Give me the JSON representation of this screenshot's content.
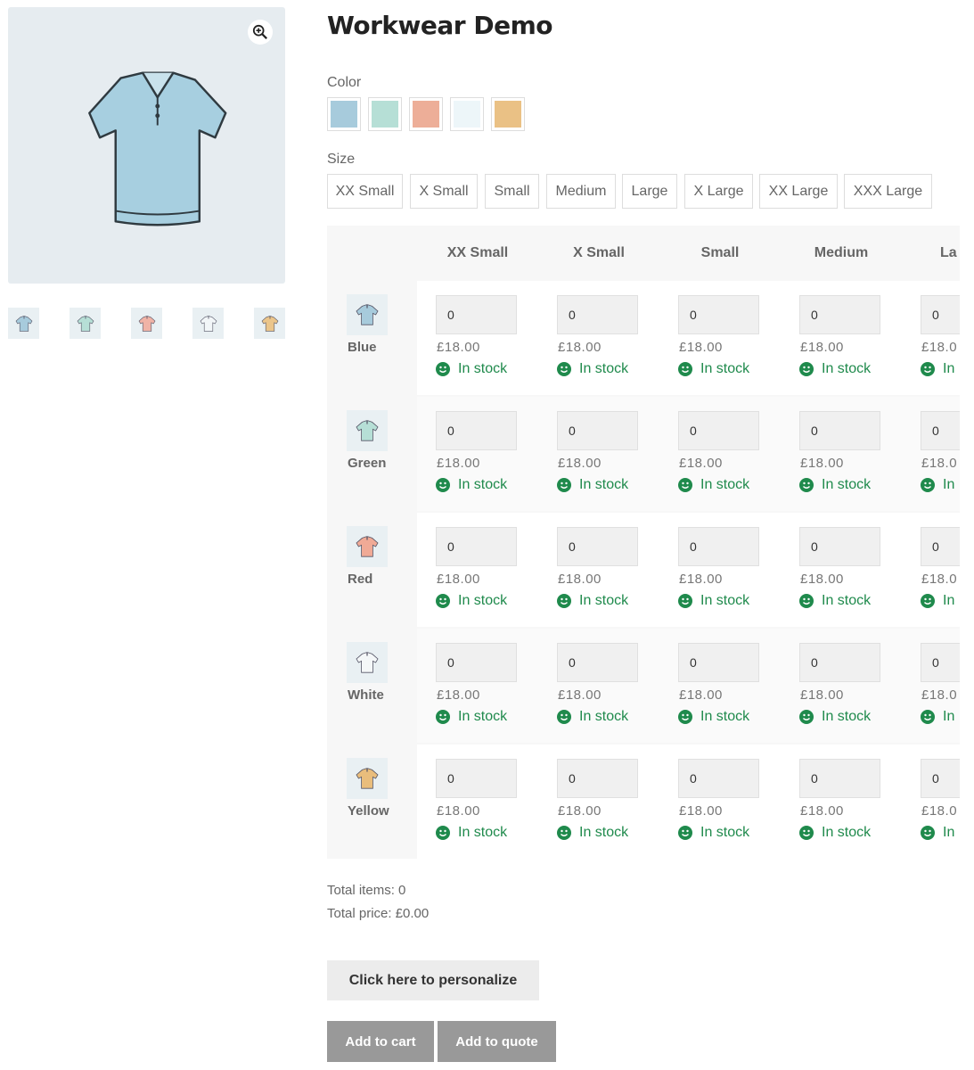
{
  "product": {
    "title": "Workwear Demo"
  },
  "gallery": {
    "zoom_icon": "zoom-in-icon",
    "thumbnails": [
      {
        "color": "#a7cbdc"
      },
      {
        "color": "#b6dfd6"
      },
      {
        "color": "#f0b3a6"
      },
      {
        "color": "#f2f6f8"
      },
      {
        "color": "#ebc58a"
      }
    ]
  },
  "attributes": {
    "color_label": "Color",
    "colors": [
      {
        "name": "Blue",
        "hex": "#a7cbdc"
      },
      {
        "name": "Green",
        "hex": "#b6dfd6"
      },
      {
        "name": "Red",
        "hex": "#edae98"
      },
      {
        "name": "White",
        "hex": "#edf6f9"
      },
      {
        "name": "Yellow",
        "hex": "#eac185"
      }
    ],
    "size_label": "Size",
    "sizes": [
      "XX Small",
      "X Small",
      "Small",
      "Medium",
      "Large",
      "X Large",
      "XX Large",
      "XXX Large"
    ]
  },
  "matrix": {
    "columns": [
      "XX Small",
      "X Small",
      "Small",
      "Medium",
      "La"
    ],
    "rows": [
      {
        "label": "Blue",
        "color": "#a7cbdc"
      },
      {
        "label": "Green",
        "color": "#b6dfd6"
      },
      {
        "label": "Red",
        "color": "#f0aa96"
      },
      {
        "label": "White",
        "color": "#f4f7f8"
      },
      {
        "label": "Yellow",
        "color": "#e9bd7c"
      }
    ],
    "qty_value": "0",
    "price": "£18.00",
    "price_truncated": "£18.0",
    "stock": "In stock",
    "stock_truncated": "In",
    "stock_color": "#1f8a4c"
  },
  "totals": {
    "items": "Total items: 0",
    "price": "Total price: £0.00"
  },
  "buttons": {
    "personalize": "Click here to personalize",
    "add_to_cart": "Add to cart",
    "add_to_quote": "Add to quote"
  }
}
